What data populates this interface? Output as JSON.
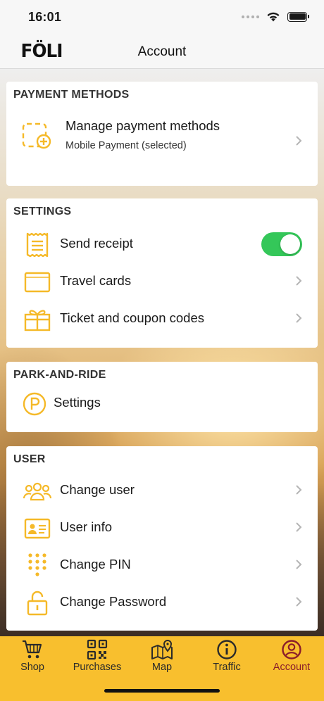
{
  "status": {
    "time": "16:01"
  },
  "nav": {
    "logo": "FÖLI",
    "title": "Account"
  },
  "payment": {
    "header": "PAYMENT METHODS",
    "title": "Manage payment methods",
    "subtitle": "Mobile Payment (selected)"
  },
  "settings": {
    "header": "SETTINGS",
    "items": [
      {
        "label": "Send receipt",
        "icon": "receipt-icon",
        "toggle": true
      },
      {
        "label": "Travel cards",
        "icon": "card-icon"
      },
      {
        "label": "Ticket and coupon codes",
        "icon": "gift-icon"
      }
    ]
  },
  "park": {
    "header": "PARK-AND-RIDE",
    "items": [
      {
        "label": "Settings",
        "icon": "parking-icon"
      }
    ]
  },
  "user": {
    "header": "USER",
    "items": [
      {
        "label": "Change user",
        "icon": "users-icon"
      },
      {
        "label": "User info",
        "icon": "id-card-icon"
      },
      {
        "label": "Change PIN",
        "icon": "keypad-icon"
      },
      {
        "label": "Change Password",
        "icon": "lock-icon"
      }
    ]
  },
  "tabs": [
    {
      "label": "Shop",
      "icon": "cart-icon"
    },
    {
      "label": "Purchases",
      "icon": "qr-code-icon"
    },
    {
      "label": "Map",
      "icon": "map-icon"
    },
    {
      "label": "Traffic",
      "icon": "info-icon"
    },
    {
      "label": "Account",
      "icon": "account-icon",
      "active": true
    }
  ],
  "colors": {
    "accent": "#f8bf2e",
    "toggle_on": "#34c759",
    "active_tab": "#8a1d2a"
  }
}
